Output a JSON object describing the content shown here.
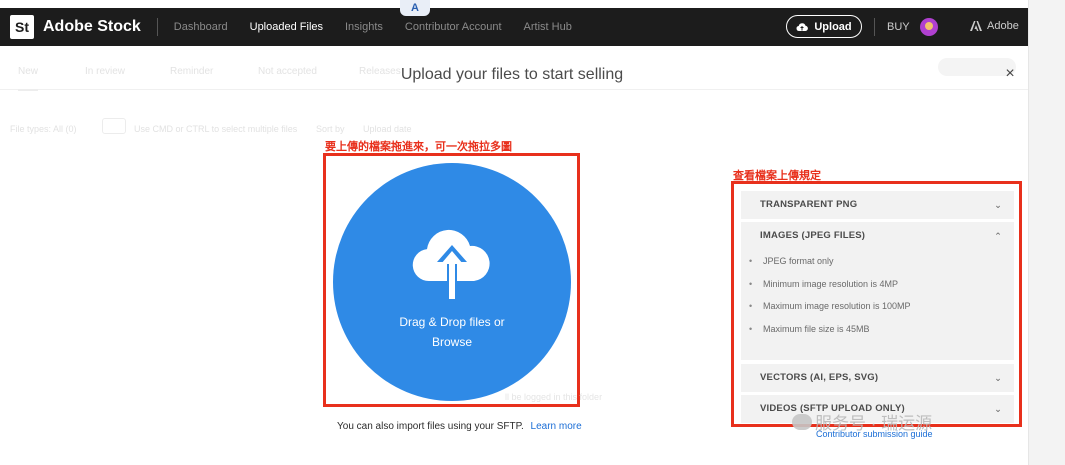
{
  "nav": {
    "logo": "St",
    "brand": "Adobe Stock",
    "items": [
      "Dashboard",
      "Uploaded Files",
      "Insights",
      "Contributor Account",
      "Artist Hub"
    ],
    "active_index": 1,
    "upload_label": "Upload",
    "buy_label": "BUY",
    "adobe_label": "Adobe",
    "translate_badge": "A"
  },
  "background": {
    "tabs": [
      "New",
      "In review",
      "Reminder",
      "Not accepted",
      "Releases"
    ],
    "filters": {
      "file_types": "File types: All (0)",
      "hint": "Use CMD or CTRL to select multiple files",
      "sort_by": "Sort by",
      "upload_date": "Upload date"
    },
    "faded_note": "ll be logged in this folder"
  },
  "modal": {
    "title": "Upload your files to start selling",
    "close_glyph": "×",
    "dropzone": {
      "line1": "Drag & Drop files or",
      "line2": "Browse"
    },
    "sftp_text": "You can also import files using your SFTP.",
    "learn_more": "Learn more",
    "rules": [
      {
        "title": "TRANSPARENT PNG",
        "expanded": false,
        "items": []
      },
      {
        "title": "IMAGES (JPEG FILES)",
        "expanded": true,
        "items": [
          "JPEG format only",
          "Minimum image resolution is 4MP",
          "Maximum image resolution is 100MP",
          "Maximum file size is 45MB"
        ]
      },
      {
        "title": "VECTORS (AI, EPS, SVG)",
        "expanded": false,
        "items": []
      },
      {
        "title": "VIDEOS (SFTP UPLOAD ONLY)",
        "expanded": false,
        "items": []
      }
    ],
    "chevron_down": "⌄",
    "chevron_up": "⌃",
    "contributor_guide": "Contributor submission guide"
  },
  "annotations": {
    "left": "要上傳的檔案拖進來，可一次拖拉多圖",
    "right": "查看檔案上傳規定"
  },
  "watermark": "服务号 · 瑞运源",
  "colors": {
    "nav_bg": "#1c1c1c",
    "dropzone_blue": "#2f8ae6",
    "annotation_red": "#e8301c",
    "link_blue": "#1b6ed6",
    "panel_bg": "#f2f2f2"
  }
}
